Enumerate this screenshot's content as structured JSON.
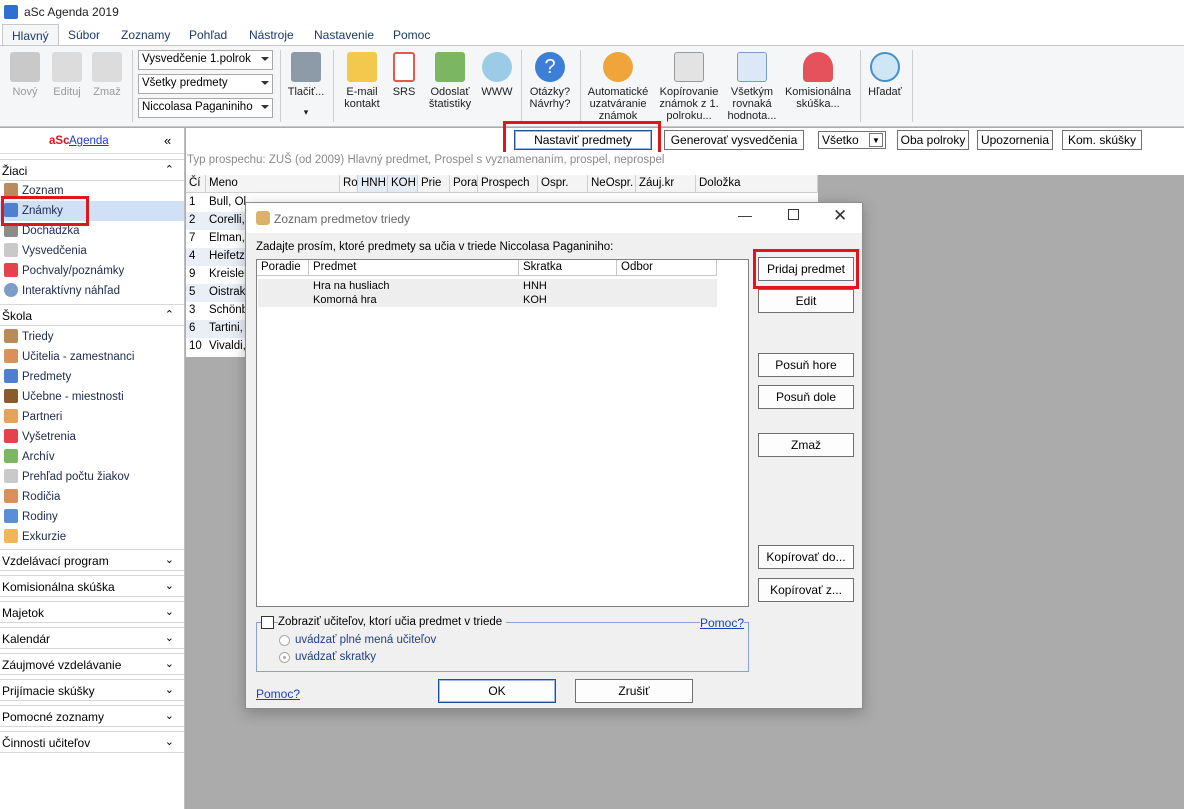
{
  "app": {
    "title": "aSc Agenda 2019"
  },
  "menu": {
    "items": [
      "Hlavný",
      "Súbor",
      "Zoznamy",
      "Pohľad",
      "Nástroje",
      "Nastavenie",
      "Pomoc"
    ]
  },
  "ribbon": {
    "new": "Nový",
    "edit": "Edituj",
    "delete": "Zmaž",
    "combo_report": "Vysvedčenie 1.polrok",
    "combo_subjects": "Všetky predmety",
    "combo_class": "Niccolasa Paganiniho",
    "print": "Tlačiť...",
    "email": "E-mail kontakt",
    "srs": "SRS",
    "send_stats": "Odoslať štatistiky",
    "www": "WWW",
    "questions": "Otázky? Návrhy?",
    "auto_close": "Automatické uzatváranie známok",
    "copy_grades": "Kopírovanie známok z 1. polroku...",
    "all_equal": "Všetkým rovnaká hodnota...",
    "commission": "Komisionálna skúška...",
    "search": "Hľadať"
  },
  "sidebar": {
    "logo_a": "aSc",
    "logo_b": "Agenda",
    "collapse": "«",
    "students": {
      "title": "Žiaci",
      "items": [
        "Zoznam",
        "Známky",
        "Dochádzka",
        "Vysvedčenia",
        "Pochvaly/poznámky",
        "Interaktívny náhľad"
      ]
    },
    "school": {
      "title": "Škola",
      "items": [
        "Triedy",
        "Učitelia - zamestnanci",
        "Predmety",
        "Učebne - miestnosti",
        "Partneri",
        "Vyšetrenia",
        "Archív",
        "Prehľad počtu žiakov",
        "Rodičia",
        "Rodiny",
        "Exkurzie"
      ]
    },
    "sections": [
      "Vzdelávací program",
      "Komisionálna skúška",
      "Majetok",
      "Kalendár",
      "Záujmové vzdelávanie",
      "Prijímacie skúšky",
      "Pomocné zoznamy",
      "Činnosti učiteľov"
    ]
  },
  "toolbar2": {
    "set_subjects": "Nastaviť predmety",
    "generate": "Generovať vysvedčenia",
    "filter": "Všetko",
    "both": "Oba polroky",
    "warnings": "Upozornenia",
    "com_exams": "Kom. skúšky",
    "info": "Typ prospechu: ZUŠ (od 2009) Hlavný predmet, Prospel s vyznamenaním, prospel, neprospel"
  },
  "grid": {
    "headers": [
      "Čí",
      "Meno",
      "Ro",
      "HNH",
      "KOH",
      "Prie",
      "Pora",
      "Prospech",
      "Ospr.",
      "NeOspr.",
      "Záuj.kr",
      "Doložka"
    ],
    "rows": [
      [
        "1",
        "Bull, Ol"
      ],
      [
        "2",
        "Corelli,"
      ],
      [
        "7",
        "Elman,"
      ],
      [
        "4",
        "Heifetz,"
      ],
      [
        "9",
        "Kreisler"
      ],
      [
        "5",
        "Oistrak"
      ],
      [
        "3",
        "Schönb"
      ],
      [
        "6",
        "Tartini,"
      ],
      [
        "10",
        "Vivaldi,"
      ]
    ]
  },
  "dialog": {
    "title": "Zoznam predmetov triedy",
    "instruction": "Zadajte prosím, ktoré predmety sa učia v triede Niccolasa Paganiniho:",
    "columns": [
      "Poradie",
      "Predmet",
      "Skratka",
      "Odbor"
    ],
    "rows": [
      {
        "subject": "Hra na husliach",
        "abbr": "HNH"
      },
      {
        "subject": "Komorná hra",
        "abbr": "KOH"
      }
    ],
    "buttons": {
      "add": "Pridaj predmet",
      "edit": "Edit",
      "up": "Posuň hore",
      "down": "Posuň dole",
      "delete": "Zmaž",
      "copy_to": "Kopírovať do...",
      "copy_from": "Kopírovať z..."
    },
    "show_teachers": "Zobraziť učiteľov, ktorí učia predmet v triede",
    "help": "Pomoc?",
    "opt_full": "uvádzať plné mená učiteľov",
    "opt_abbr": "uvádzať skratky",
    "ok": "OK",
    "cancel": "Zrušiť"
  }
}
